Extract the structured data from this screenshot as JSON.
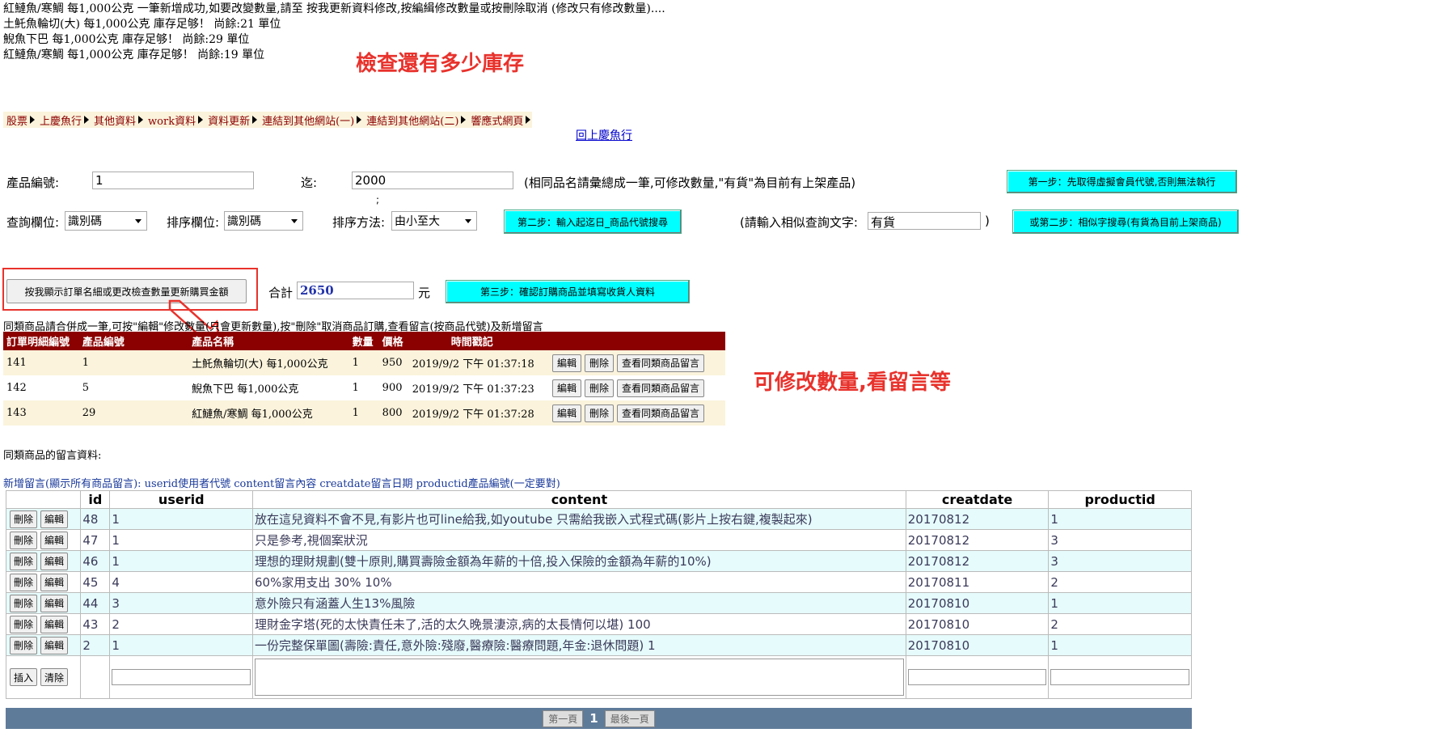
{
  "messages": [
    "紅鰱魚/寒鯛 每1,000公克 一筆新增成功,如要改變數量,請至 按我更新資料修改,按編緝修改數量或按刪除取消 (修改只有修改數量)....",
    "土魠魚輪切(大) 每1,000公克 庫存足够！ 尚餘:21 單位",
    "鯢魚下巴 每1,000公克 庫存足够！ 尚餘:29 單位",
    "紅鰱魚/寒鯛 每1,000公克 庫存足够！ 尚餘:19 單位"
  ],
  "annotations": {
    "stock_check": "檢查還有多少庫存",
    "edit_hint": "可修改數量,看留言等"
  },
  "menu": [
    "股票",
    "上慶魚行",
    "其他資料",
    "work資料",
    "資料更新",
    "連結到其他網站(一)",
    "連結到其他網站(二)",
    "響應式網頁"
  ],
  "back_link": "回上慶魚行",
  "form": {
    "product_no_label": "產品編號:",
    "product_no_value": "1",
    "to_label": "迄:",
    "to_value": "2000",
    "semicolon": ";",
    "note": "(相同品名請彙總成一筆,可修改數量,\"有貨\"為目前有上架產品)",
    "step1": "第一步：先取得虛擬會員代號,否則無法執行",
    "query_field_label": "查詢欄位:",
    "query_field_value": "識別碼",
    "sort_field_label": "排序欄位:",
    "sort_field_value": "識別碼",
    "sort_method_label": "排序方法:",
    "sort_method_value": "由小至大",
    "step2": "第二步：輸入起迄日_商品代號搜尋",
    "similar_label": "(請輸入相似查詢文字:",
    "similar_value": "有貨",
    "similar_close": ")",
    "step2b": "或第二步：相似字搜尋(有貨為目前上架商品)"
  },
  "order": {
    "update_button": "按我顯示訂單名細或更改檢查數量更新購買金額",
    "total_label": "合計",
    "total_value": "2650",
    "currency": "元",
    "step3": "第三步：確認訂購商品並填寫收貨人資料",
    "instructions": "同類商品請合併成一筆,可按\"編輯\"修改數量(只會更新數量),按\"刪除\"取消商品訂購,查看留言(按商品代號)及新增留言",
    "headers": [
      "訂單明細編號",
      "產品編號",
      "產品名稱",
      "數量",
      "價格",
      "時間戳記"
    ],
    "rows": [
      {
        "detail_id": "141",
        "product_id": "1",
        "name": "土魠魚輪切(大) 每1,000公克",
        "qty": "1",
        "price": "950",
        "time": "2019/9/2 下午 01:37:18"
      },
      {
        "detail_id": "142",
        "product_id": "5",
        "name": "鯢魚下巴 每1,000公克",
        "qty": "1",
        "price": "900",
        "time": "2019/9/2 下午 01:37:23"
      },
      {
        "detail_id": "143",
        "product_id": "29",
        "name": "紅鰱魚/寒鯛 每1,000公克",
        "qty": "1",
        "price": "800",
        "time": "2019/9/2 下午 01:37:28"
      }
    ],
    "edit": "編輯",
    "delete": "刪除",
    "view_comments": "查看同類商品留言"
  },
  "comments": {
    "title": "同類商品的留言資料:",
    "add_link": "新增留言(顯示所有商品留言): userid使用者代號 content留言內容 creatdate留言日期 productid產品編號(一定要對)",
    "headers": [
      "",
      "id",
      "userid",
      "content",
      "creatdate",
      "productid"
    ],
    "delete": "刪除",
    "edit": "編輯",
    "insert": "插入",
    "clear": "清除",
    "rows": [
      {
        "id": "48",
        "userid": "1",
        "content": "放在這兒資料不會不見,有影片也可line給我,如youtube 只需給我嵌入式程式碼(影片上按右鍵,複製起來)",
        "creatdate": "20170812",
        "productid": "1"
      },
      {
        "id": "47",
        "userid": "1",
        "content": "只是參考,視個案狀況",
        "creatdate": "20170812",
        "productid": "3"
      },
      {
        "id": "46",
        "userid": "1",
        "content": "理想的理財規劃(雙十原則,購買壽險金額為年薪的十倍,投入保險的金額為年薪的10%)",
        "creatdate": "20170812",
        "productid": "3"
      },
      {
        "id": "45",
        "userid": "4",
        "content": "60%家用支出 30% 10%",
        "creatdate": "20170811",
        "productid": "2"
      },
      {
        "id": "44",
        "userid": "3",
        "content": "意外險只有涵蓋人生13%風險",
        "creatdate": "20170810",
        "productid": "1"
      },
      {
        "id": "43",
        "userid": "2",
        "content": "理財金字塔(死的太快責任未了,活的太久晚景淒涼,病的太長情何以堪) 100",
        "creatdate": "20170810",
        "productid": "2"
      },
      {
        "id": "2",
        "userid": "1",
        "content": "一份完整保單圖(壽險:責任,意外險:殘廢,醫療險:醫療問題,年金:退休問題) 1",
        "creatdate": "20170810",
        "productid": "1"
      }
    ]
  },
  "pager": {
    "first": "第一頁",
    "current": "1",
    "last": "最後一頁"
  },
  "colors": {
    "accent_red": "#e8322c",
    "header_dark_red": "#8b0000",
    "cyan_button": "#00ffff",
    "pager_bar": "#5f7b9a",
    "row_cream": "#fbf3dc",
    "row_cyan": "#e6fbfb"
  }
}
